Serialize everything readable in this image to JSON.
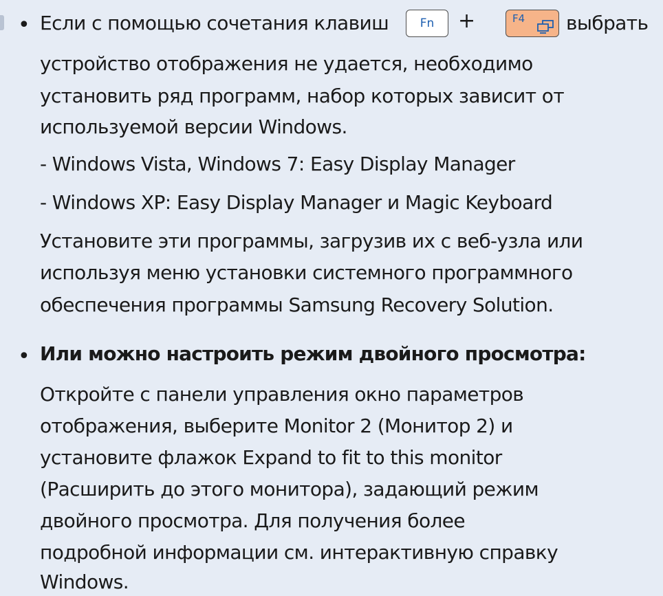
{
  "section1": {
    "line1_text": "Если с помощью сочетания клавиш",
    "keys": {
      "fn_label": "Fn",
      "plus": "+",
      "f4_label": "F4",
      "f4_icon": "dual-monitor-icon"
    },
    "line1_end": "выбрать",
    "para": [
      "устройство отображения не удается, необходимо",
      "установить ряд программ, набор которых зависит от",
      "используемой версии Windows."
    ],
    "list": [
      "- Windows Vista, Windows 7: Easy Display Manager",
      "- Windows XP: Easy Display Manager и Magic Keyboard"
    ],
    "install": [
      "Установите эти программы, загрузив их с веб-узла или",
      "используя меню установки системного программного",
      "обеспечения программы Samsung Recovery Solution."
    ]
  },
  "section2": {
    "heading": "Или можно настроить режим двойного просмотра:",
    "body": [
      "Откройте с панели управления окно параметров",
      "отображения, выберите Monitor 2 (Монитор 2) и",
      "установите флажок Expand to fit to this monitor",
      "(Расширить до этого монитора), задающий режим",
      "двойного просмотра. Для получения более",
      "подробной информации см. интерактивную справку",
      "Windows."
    ]
  },
  "colors": {
    "background": "#e6ecf5",
    "key_fn_bg": "#ffffff",
    "key_f4_bg": "#f6b489",
    "key_text": "#1d5fb0"
  }
}
